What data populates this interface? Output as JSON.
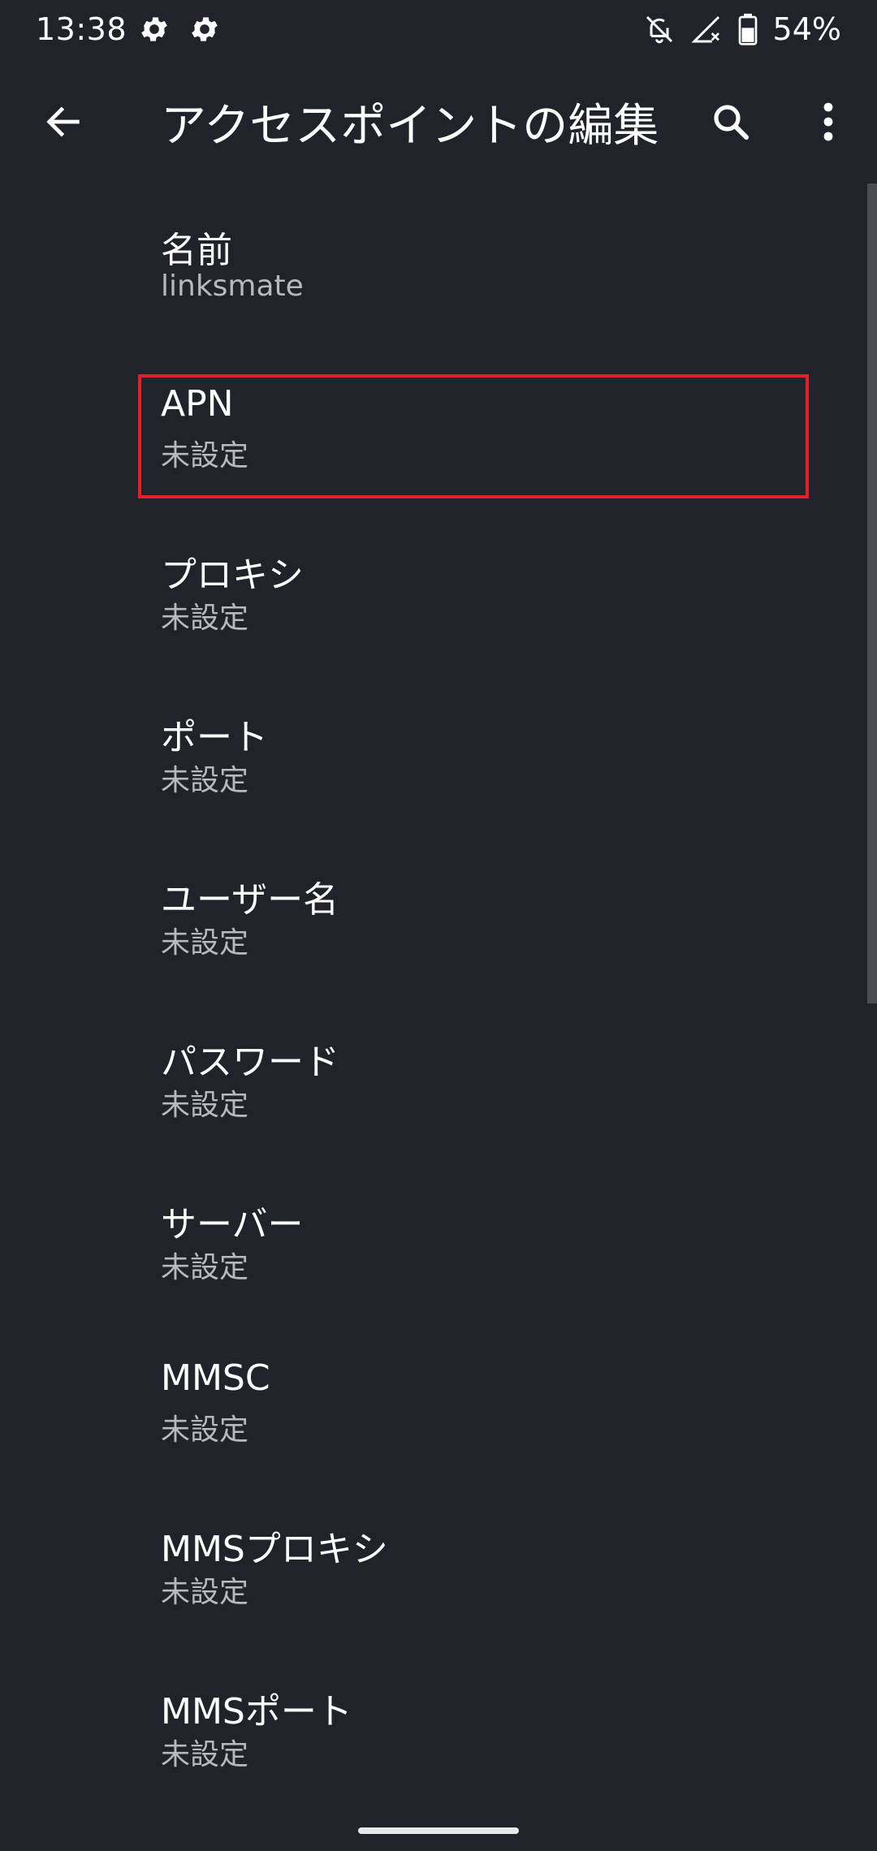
{
  "status_bar": {
    "time": "13:38",
    "battery_percent": "54%",
    "icons": [
      "gear-icon",
      "gear-icon",
      "notifications-off-icon",
      "no-signal-icon",
      "battery-icon"
    ]
  },
  "app_bar": {
    "title": "アクセスポイントの編集",
    "back_icon": "arrow-back-icon",
    "search_icon": "search-icon",
    "more_icon": "more-vert-icon"
  },
  "preferences": [
    {
      "title": "名前",
      "summary": "linksmate"
    },
    {
      "title": "APN",
      "summary": "未設定"
    },
    {
      "title": "プロキシ",
      "summary": "未設定"
    },
    {
      "title": "ポート",
      "summary": "未設定"
    },
    {
      "title": "ユーザー名",
      "summary": "未設定"
    },
    {
      "title": "パスワード",
      "summary": "未設定"
    },
    {
      "title": "サーバー",
      "summary": "未設定"
    },
    {
      "title": "MMSC",
      "summary": "未設定"
    },
    {
      "title": "MMSプロキシ",
      "summary": "未設定"
    },
    {
      "title": "MMSポート",
      "summary": "未設定"
    }
  ],
  "colors": {
    "background": "#202329",
    "text_primary": "#ffffff",
    "text_secondary": "#b6b9be",
    "highlight": "#e0202a"
  }
}
